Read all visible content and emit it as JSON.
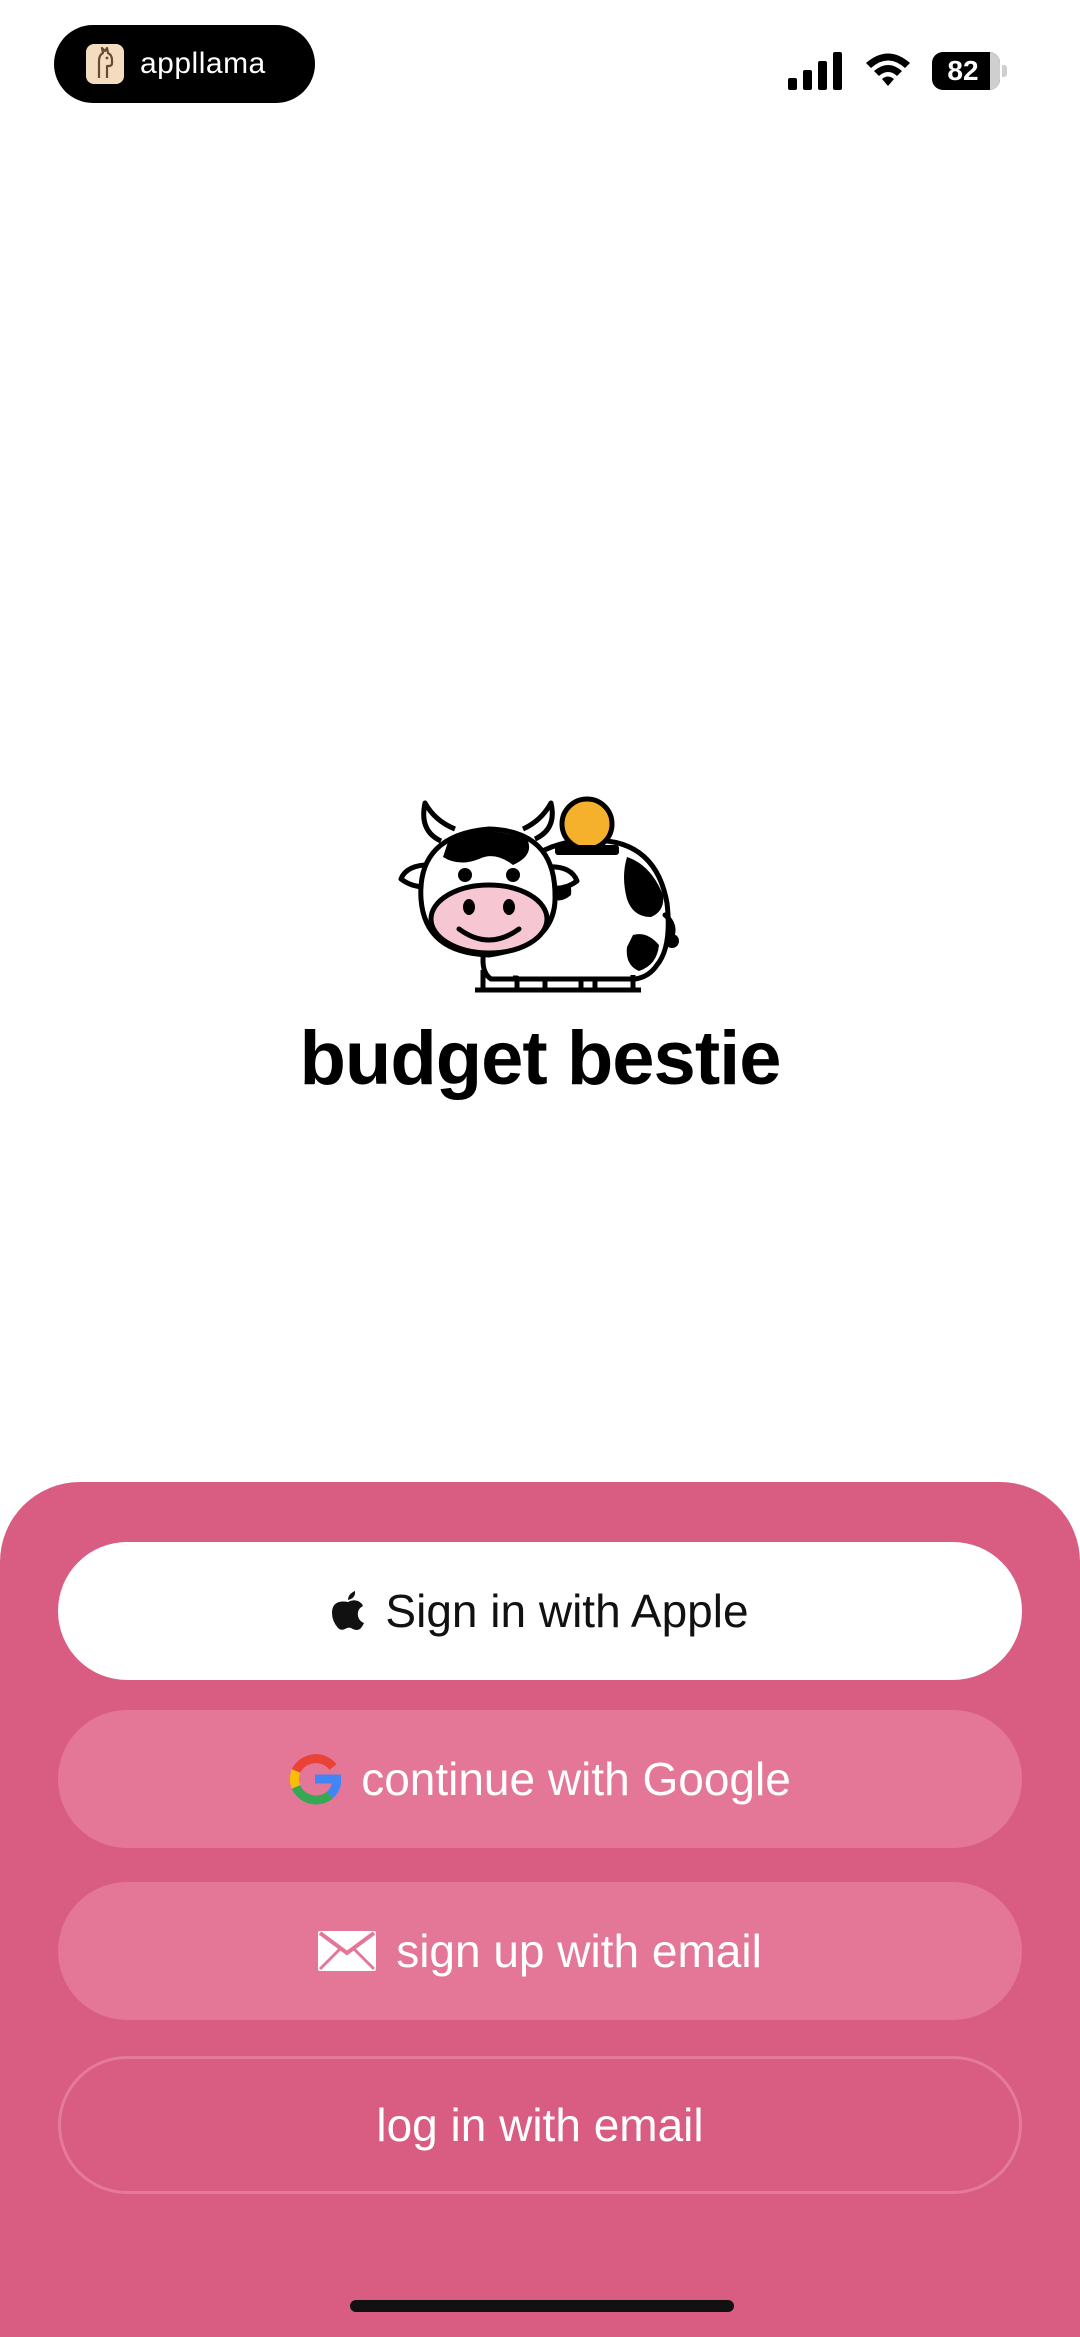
{
  "status_bar": {
    "app_badge": "appllama",
    "battery_percent": "82",
    "icons": [
      "llama-icon",
      "cellular-signal-icon",
      "wifi-icon",
      "battery-icon"
    ]
  },
  "app": {
    "title": "budget bestie",
    "logo_icon": "cow-piggy-bank-icon",
    "colors": {
      "sheet": "#d95d82",
      "secondary_button": "#e47697",
      "coin": "#f6b12c",
      "nose": "#f7c6d3"
    }
  },
  "auth": {
    "apple_label": "Sign in with Apple",
    "google_label": "continue with Google",
    "signup_email_label": "sign up with email",
    "login_email_label": "log in with email"
  }
}
